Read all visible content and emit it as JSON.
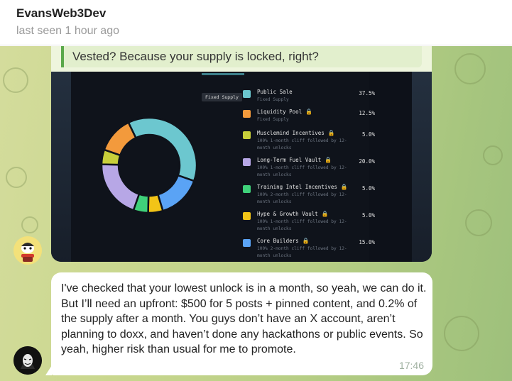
{
  "header": {
    "title": "EvansWeb3Dev",
    "status": "last seen 1 hour ago"
  },
  "reply": {
    "text": "Vested? Because your supply is locked, right?"
  },
  "token_image": {
    "tooltip": "Fixed Supply",
    "allocations": [
      {
        "name": "Public Sale",
        "locked": false,
        "desc": "Fixed Supply",
        "pct": "37.5%",
        "value": 37.5,
        "color": "#6cc7cf"
      },
      {
        "name": "Liquidity Pool",
        "locked": true,
        "desc": "Fixed Supply",
        "pct": "12.5%",
        "value": 12.5,
        "color": "#f39a3c"
      },
      {
        "name": "Musclemind Incentives",
        "locked": true,
        "desc": "100% 1-month cliff followed by 12-month unlocks",
        "pct": "5.0%",
        "value": 5.0,
        "color": "#c8cf3a"
      },
      {
        "name": "Long-Term Fuel Vault",
        "locked": true,
        "desc": "100% 1-month cliff followed by 12-month unlocks",
        "pct": "20.0%",
        "value": 20.0,
        "color": "#b7a7e6"
      },
      {
        "name": "Training Intel Incentives",
        "locked": true,
        "desc": "100% 2-month cliff followed by 12-month unlocks",
        "pct": "5.0%",
        "value": 5.0,
        "color": "#3fd17a"
      },
      {
        "name": "Hype & Growth Vault",
        "locked": true,
        "desc": "100% 1-month cliff followed by 12-month unlocks",
        "pct": "5.0%",
        "value": 5.0,
        "color": "#f2c417"
      },
      {
        "name": "Core Builders",
        "locked": true,
        "desc": "100% 2-month cliff followed by 12-month unlocks",
        "pct": "15.0%",
        "value": 15.0,
        "color": "#5aa3f5"
      }
    ]
  },
  "message": {
    "text": "I've checked that your lowest unlock is in a month, so yeah, we can do it. But I’ll need an upfront: $500 for 5 posts + pinned content, and 0.2% of the supply after a month. You guys don’t have an X account, aren’t planning to doxx, and haven’t done any hackathons or public events. So yeah, higher risk than usual for me to promote.",
    "time": "17:46"
  }
}
